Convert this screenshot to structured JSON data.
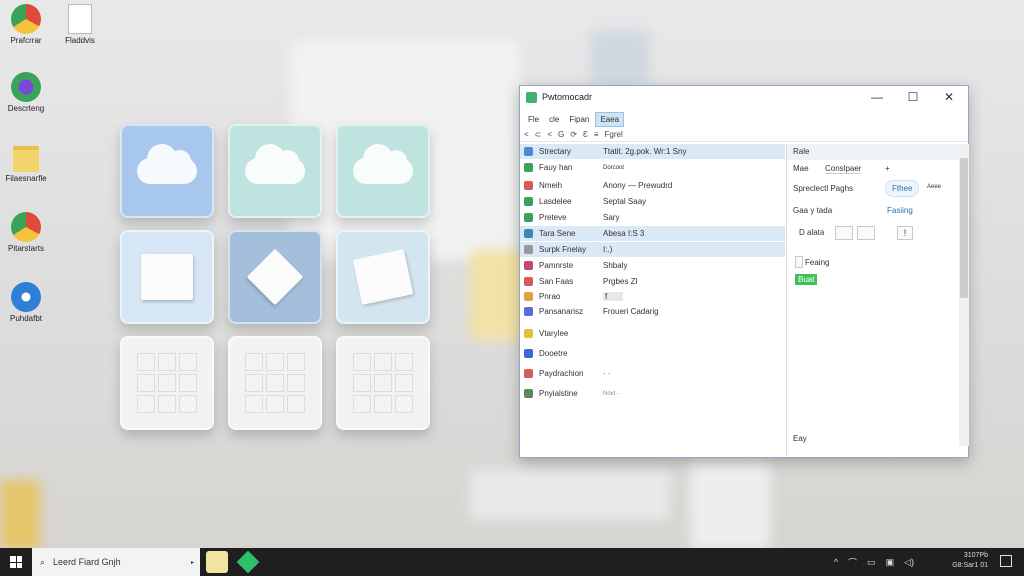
{
  "desktop": {
    "icons": [
      {
        "label": "Prafcrrar",
        "icon": "chrome-icon"
      },
      {
        "label": "Fladdvis",
        "icon": "document-icon"
      },
      {
        "label": "Descrteng",
        "icon": "media-icon"
      },
      {
        "label": "Filaesnarfle",
        "icon": "folder-icon"
      },
      {
        "label": "Pitarstarts",
        "icon": "chrome-icon"
      },
      {
        "label": "Puhdafbt",
        "icon": "globe-icon"
      }
    ]
  },
  "window": {
    "title": "Pwtomocadr",
    "controls": {
      "minimize": "—",
      "maximize": "☐",
      "close": "✕"
    },
    "menus": [
      "Fle",
      "cle",
      "Fipan",
      "Eaea"
    ],
    "toolbar": [
      "<",
      "⊂",
      "<",
      "G",
      "⟳",
      "Ɛ",
      "≡",
      "Fgrel"
    ],
    "rows": [
      {
        "label": "Strectary",
        "value": "Ttatit. 2g.pok. Wr:1 Sny",
        "color": "#4a8ad4"
      },
      {
        "label": "Fauy han",
        "value": "Dorcoot",
        "color": "#3aa35a"
      },
      {
        "label": "Nmeih",
        "value": "Anony — Prewudrd",
        "color": "#d65a5a"
      },
      {
        "label": "Lasdelee",
        "value": "Septal Saay",
        "color": "#3aa35a"
      },
      {
        "label": "Preteve",
        "value": "Sary",
        "color": "#3aa35a"
      },
      {
        "label": "Tara Sene",
        "value": "Abesa I:S 3",
        "color": "#3a8ab0"
      },
      {
        "label": "Surpk Fnelay",
        "value": "I:.)",
        "color": "#999999"
      },
      {
        "label": "Pamnrste",
        "value": "Shbaly",
        "color": "#c24a6a"
      },
      {
        "label": "San Faas",
        "value": "Prgbes ZI",
        "color": "#d65a5a"
      },
      {
        "label": "Pnrao",
        "value": "f",
        "color": "#e0a040"
      },
      {
        "label": "Pansanarisz",
        "value": "Froueri Cadarig",
        "color": "#5a6ad6"
      },
      {
        "label": "Vtarylee",
        "value": "",
        "color": "#e0c040"
      },
      {
        "label": "Dooetre",
        "value": "",
        "color": "#3a6ad6"
      },
      {
        "label": "Paydrachion",
        "value": "·  ·",
        "color": "#d65a5a"
      },
      {
        "label": "Pnyialstine",
        "value": "Novt·  ·",
        "color": "#5a8a5a"
      }
    ],
    "right": {
      "header": "Rale",
      "tab1": "Mae",
      "tab2": "Conslpaer",
      "tab3": "+",
      "line1": "Spreclectl Paghs",
      "line1b": "Fthee",
      "line1c": "Aeee",
      "line2": "Gaa y tada",
      "line2b": "Fasiing",
      "line3": "D alata",
      "line3b": "!",
      "line4": "Feaing",
      "line5": "Buat",
      "footer": "Eay"
    }
  },
  "taskbar": {
    "search_placeholder": "Leerd Fiard Gnjh",
    "clock_line1": "3107Pb",
    "clock_line2": "G8:Sar1 01"
  }
}
